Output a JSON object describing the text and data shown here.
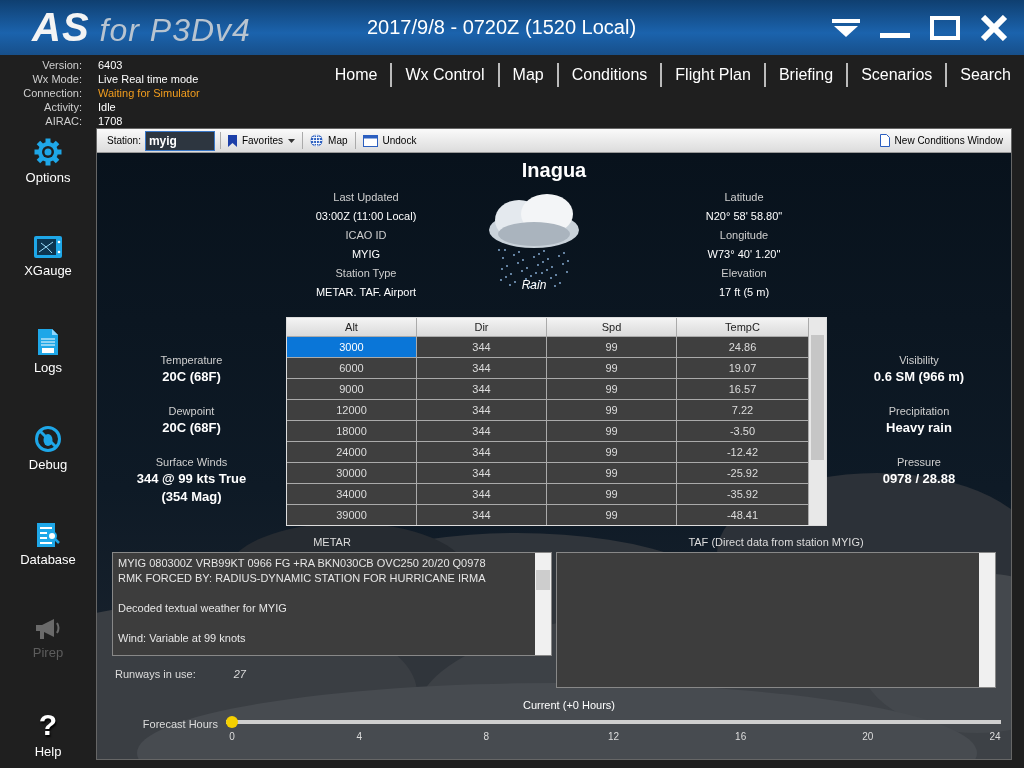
{
  "header": {
    "logo_main": "AS",
    "logo_sub": "for P3Dv4",
    "datetime": "2017/9/8 - 0720Z (1520 Local)"
  },
  "status": [
    {
      "label": "Version:",
      "value": "6403",
      "kind": "normal"
    },
    {
      "label": "Wx Mode:",
      "value": "Live Real time mode",
      "kind": "normal"
    },
    {
      "label": "Connection:",
      "value": "Waiting for Simulator",
      "kind": "warning"
    },
    {
      "label": "Activity:",
      "value": "Idle",
      "kind": "normal"
    },
    {
      "label": "AIRAC:",
      "value": "1708",
      "kind": "normal"
    }
  ],
  "nav": [
    "Home",
    "Wx Control",
    "Map",
    "Conditions",
    "Flight Plan",
    "Briefing",
    "Scenarios",
    "Search"
  ],
  "sidebar": [
    {
      "label": "Options",
      "kind": "gear",
      "disabled": false
    },
    {
      "label": "XGauge",
      "kind": "gauge",
      "disabled": false
    },
    {
      "label": "Logs",
      "kind": "log",
      "disabled": false
    },
    {
      "label": "Debug",
      "kind": "debug",
      "disabled": false
    },
    {
      "label": "Database",
      "kind": "database",
      "disabled": false
    },
    {
      "label": "Pirep",
      "kind": "megaphone",
      "disabled": true
    },
    {
      "label": "Help",
      "kind": "help",
      "glyph": "?",
      "disabled": false
    }
  ],
  "toolbar": {
    "station_label": "Station:",
    "station_value": "myig",
    "buttons": [
      {
        "label": "Favorites",
        "kind": "favorites"
      },
      {
        "label": "Map",
        "kind": "map"
      },
      {
        "label": "Undock",
        "kind": "undock"
      }
    ],
    "right_button": "New Conditions Window"
  },
  "station": {
    "name": "Inagua",
    "condition": "Rain",
    "left": [
      {
        "label": "Last Updated",
        "value": "03:00Z (11:00 Local)"
      },
      {
        "label": "ICAO ID",
        "value": "MYIG"
      },
      {
        "label": "Station Type",
        "value": "METAR. TAF. Airport"
      }
    ],
    "right": [
      {
        "label": "Latitude",
        "value": "N20° 58' 58.80\""
      },
      {
        "label": "Longitude",
        "value": "W73° 40' 1.20\""
      },
      {
        "label": "Elevation",
        "value": "17 ft (5 m)"
      }
    ]
  },
  "stats_left": [
    {
      "label": "Temperature",
      "values": [
        "20C (68F)"
      ]
    },
    {
      "label": "Dewpoint",
      "values": [
        "20C (68F)"
      ]
    },
    {
      "label": "Surface Winds",
      "values": [
        "344 @ 99 kts True",
        "(354 Mag)"
      ]
    }
  ],
  "stats_right": [
    {
      "label": "Visibility",
      "values": [
        "0.6 SM (966 m)"
      ]
    },
    {
      "label": "Precipitation",
      "values": [
        "Heavy rain"
      ]
    },
    {
      "label": "Pressure",
      "values": [
        "0978 / 28.88"
      ]
    }
  ],
  "table": {
    "columns": [
      "Alt",
      "Dir",
      "Spd",
      "TempC"
    ],
    "rows": [
      {
        "cells": [
          "3000",
          "344",
          "99",
          "24.86"
        ],
        "selected": true
      },
      {
        "cells": [
          "6000",
          "344",
          "99",
          "19.07"
        ],
        "selected": false
      },
      {
        "cells": [
          "9000",
          "344",
          "99",
          "16.57"
        ],
        "selected": false
      },
      {
        "cells": [
          "12000",
          "344",
          "99",
          "7.22"
        ],
        "selected": false
      },
      {
        "cells": [
          "18000",
          "344",
          "99",
          "-3.50"
        ],
        "selected": false
      },
      {
        "cells": [
          "24000",
          "344",
          "99",
          "-12.42"
        ],
        "selected": false
      },
      {
        "cells": [
          "30000",
          "344",
          "99",
          "-25.92"
        ],
        "selected": false
      },
      {
        "cells": [
          "34000",
          "344",
          "99",
          "-35.92"
        ],
        "selected": false
      },
      {
        "cells": [
          "39000",
          "344",
          "99",
          "-48.41"
        ],
        "selected": false
      }
    ]
  },
  "metar": {
    "label": "METAR",
    "paragraphs": [
      [
        "MYIG 080300Z VRB99KT 0966 FG +RA BKN030CB OVC250 20/20 Q0978",
        "RMK FORCED BY: RADIUS-DYNAMIC STATION FOR HURRICANE IRMA"
      ],
      [
        "Decoded textual weather for MYIG"
      ],
      [
        "Wind: Variable at 99 knots"
      ]
    ]
  },
  "taf": {
    "label": "TAF (Direct data from station MYIG)"
  },
  "runways": {
    "label": "Runways in use:",
    "value": "27"
  },
  "forecast": {
    "label": "Forecast Hours",
    "current": "Current (+0 Hours)",
    "level": 0,
    "ticks": [
      "0",
      "4",
      "8",
      "12",
      "16",
      "20",
      "24"
    ]
  }
}
